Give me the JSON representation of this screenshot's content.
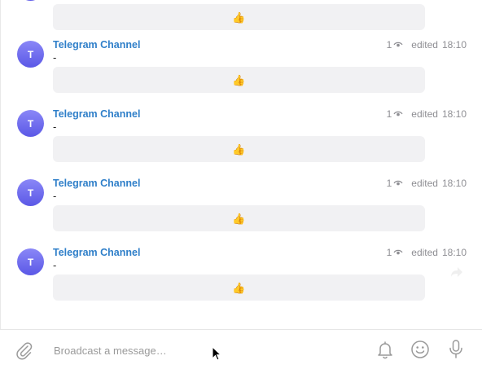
{
  "feed": {
    "top_reaction": {
      "emoji": "👍"
    },
    "messages": [
      {
        "avatar_initial": "T",
        "sender": "Telegram Channel",
        "text": "-",
        "views": "1",
        "edited": "edited",
        "time": "18:10",
        "reaction": "👍"
      },
      {
        "avatar_initial": "T",
        "sender": "Telegram Channel",
        "text": "-",
        "views": "1",
        "edited": "edited",
        "time": "18:10",
        "reaction": "👍"
      },
      {
        "avatar_initial": "T",
        "sender": "Telegram Channel",
        "text": "-",
        "views": "1",
        "edited": "edited",
        "time": "18:10",
        "reaction": "👍"
      },
      {
        "avatar_initial": "T",
        "sender": "Telegram Channel",
        "text": "-",
        "views": "1",
        "edited": "edited",
        "time": "18:10",
        "reaction": "👍"
      }
    ]
  },
  "composer": {
    "placeholder": "Broadcast a message…",
    "icons": {
      "attach": "paperclip-icon",
      "notifications": "bell-icon",
      "emoji": "smiley-icon",
      "voice": "microphone-icon"
    }
  },
  "colors": {
    "sender_name": "#2f7fc9",
    "avatar_top": "#8a87f7",
    "avatar_bottom": "#5b58e6",
    "reaction_bg": "#f1f1f3",
    "meta_text": "#8e8e93"
  }
}
